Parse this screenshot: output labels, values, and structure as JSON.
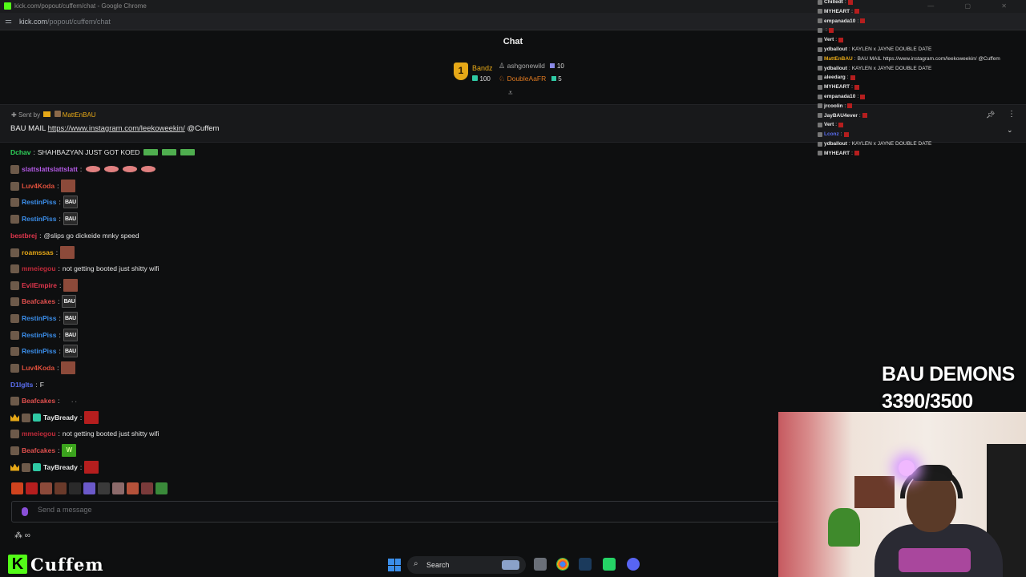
{
  "browser": {
    "tab_title": "kick.com/popout/cuffem/chat - Google Chrome",
    "url_host": "kick.com",
    "url_path": "/popout/cuffem/chat",
    "window_controls": "— ▢ ✕"
  },
  "chat": {
    "title": "Chat",
    "leaderboard": {
      "first": {
        "name": "Bandz",
        "value": "100",
        "rank": "1"
      },
      "others": [
        {
          "name": "ashgonewild",
          "value": "10"
        },
        {
          "name": "DoubleAaFR",
          "value": "5"
        }
      ]
    },
    "pinned": {
      "sent_by_label": "Sent by",
      "sent_by_user": "MattEnBAU",
      "text_prefix": "BAU MAIL",
      "link": "https://www.instagram.com/leekoweekin/",
      "mention": "@Cuffem"
    },
    "messages": [
      {
        "user": "Dchav",
        "color": "#2fd35a",
        "text": "SHAHBAZYAN JUST GOT KOED",
        "emotes": [
          "sq",
          "sq",
          "sq"
        ],
        "badges": []
      },
      {
        "user": "slattslattslattslatt",
        "color": "#b45ae6",
        "text": "",
        "emotes": [
          "pink",
          "pink",
          "pink",
          "pink"
        ],
        "badges": [
          "avatar"
        ]
      },
      {
        "user": "Luv4Koda",
        "color": "#e0503c",
        "text": "",
        "emotes": [
          "face"
        ],
        "badges": [
          "avatar"
        ]
      },
      {
        "user": "RestinPiss",
        "color": "#3b8eea",
        "text": "",
        "emotes": [
          "bau"
        ],
        "badges": [
          "avatar"
        ]
      },
      {
        "user": "RestinPiss",
        "color": "#3b8eea",
        "text": "",
        "emotes": [
          "bau"
        ],
        "badges": [
          "avatar"
        ]
      },
      {
        "user": "bestbrej",
        "color": "#e0364d",
        "text": "@slips go dickeide mnky speed",
        "emotes": [],
        "badges": []
      },
      {
        "user": "roamssas",
        "color": "#e6a817",
        "text": "",
        "emotes": [
          "face"
        ],
        "badges": [
          "avatar"
        ]
      },
      {
        "user": "mmeiegou",
        "color": "#c12a3a",
        "text": "not getting booted just shitty wifi",
        "emotes": [],
        "badges": [
          "avatar"
        ]
      },
      {
        "user": "EvilEmpire",
        "color": "#e0364d",
        "text": "",
        "emotes": [
          "face"
        ],
        "badges": [
          "avatar"
        ]
      },
      {
        "user": "Beafcakes",
        "color": "#e0504e",
        "text": "",
        "emotes": [
          "bau"
        ],
        "badges": [
          "avatar"
        ]
      },
      {
        "user": "RestinPiss",
        "color": "#3b8eea",
        "text": "",
        "emotes": [
          "bau"
        ],
        "badges": [
          "avatar"
        ]
      },
      {
        "user": "RestinPiss",
        "color": "#3b8eea",
        "text": "",
        "emotes": [
          "bau"
        ],
        "badges": [
          "avatar"
        ]
      },
      {
        "user": "RestinPiss",
        "color": "#3b8eea",
        "text": "",
        "emotes": [
          "bau"
        ],
        "badges": [
          "avatar"
        ]
      },
      {
        "user": "Luv4Koda",
        "color": "#e0503c",
        "text": "",
        "emotes": [
          "face"
        ],
        "badges": [
          "avatar"
        ]
      },
      {
        "user": "D1lgIts",
        "color": "#5a6ef0",
        "text": "F",
        "emotes": [],
        "badges": []
      },
      {
        "user": "Beafcakes",
        "color": "#e0504e",
        "text": "",
        "emotes": [
          "dots"
        ],
        "badges": [
          "avatar"
        ]
      },
      {
        "user": "TayBready",
        "color": "#e8e8e8",
        "text": "",
        "emotes": [
          "red"
        ],
        "badges": [
          "crown",
          "avatar",
          "sub"
        ]
      },
      {
        "user": "mmeiegou",
        "color": "#c12a3a",
        "text": "not getting booted just shitty wifi",
        "emotes": [],
        "badges": [
          "avatar"
        ]
      },
      {
        "user": "Beafcakes",
        "color": "#e0504e",
        "text": "",
        "emotes": [
          "w"
        ],
        "badges": [
          "avatar"
        ]
      },
      {
        "user": "TayBready",
        "color": "#e8e8e8",
        "text": "",
        "emotes": [
          "red"
        ],
        "badges": [
          "crown",
          "avatar",
          "sub"
        ]
      }
    ],
    "emote_labels": {
      "bau": "BAU",
      "w": "W",
      "face": "",
      "red": "",
      "dots": ". .",
      "sq": "",
      "pink": ""
    },
    "emote_bar_colors": [
      "#d0431e",
      "#b51e1e",
      "#8c4a3a",
      "#6a3a2a",
      "#2a2a2a",
      "#6b59c9",
      "#3a3a3a",
      "#8c6a6a",
      "#b5523a",
      "#7a3a3a",
      "#3a8a3a"
    ],
    "input_placeholder": "Send a message",
    "input_tools": "⁂ ∞"
  },
  "overlay_chat": [
    {
      "user": "Chilledt",
      "color": "#e6e6e6",
      "text": ""
    },
    {
      "user": "MYHEART",
      "color": "#e6e6e6",
      "text": ""
    },
    {
      "user": "empanada10",
      "color": "#e6e6e6",
      "text": ""
    },
    {
      "user": "",
      "color": "#c12a3a",
      "text": ""
    },
    {
      "user": "Vert",
      "color": "#e6e6e6",
      "text": ""
    },
    {
      "user": "ydballout",
      "color": "#e6e6e6",
      "text": "KAYLEN x JAYNE DOUBLE DATE"
    },
    {
      "user": "MattEnBAU",
      "color": "#e6a817",
      "text": "BAU MAIL https://www.instagram.com/leekoweekin/ @Cuffem"
    },
    {
      "user": "ydballout",
      "color": "#e6e6e6",
      "text": "KAYLEN x JAYNE DOUBLE DATE"
    },
    {
      "user": "aleedarg",
      "color": "#e6e6e6",
      "text": ""
    },
    {
      "user": "MYHEART",
      "color": "#e6e6e6",
      "text": ""
    },
    {
      "user": "empanada10",
      "color": "#e6e6e6",
      "text": ""
    },
    {
      "user": "jrcoolin",
      "color": "#e6e6e6",
      "text": ""
    },
    {
      "user": "JayBAU4ever",
      "color": "#e6e6e6",
      "text": ""
    },
    {
      "user": "Vert",
      "color": "#e6e6e6",
      "text": ""
    },
    {
      "user": "Lconz",
      "color": "#5a6ef0",
      "text": ""
    },
    {
      "user": "ydballout",
      "color": "#e6e6e6",
      "text": "KAYLEN x JAYNE DOUBLE DATE"
    },
    {
      "user": "MYHEART",
      "color": "#e6e6e6",
      "text": ""
    }
  ],
  "stream": {
    "goal_title": "BAU DEMONS",
    "goal_progress": "3390/3500",
    "goal_fraction": 0.9686,
    "channel_name": "Cuffem",
    "kick_letter": "K"
  },
  "taskbar": {
    "search_label": "Search",
    "search_icon": "⌕",
    "apps": [
      "file-explorer-icon",
      "chrome-icon",
      "steam-icon",
      "whatsapp-icon",
      "discord-icon"
    ]
  },
  "colors": {
    "kick_green": "#53fc18",
    "background": "#0e0f10",
    "accent_gold": "#e6a817"
  }
}
